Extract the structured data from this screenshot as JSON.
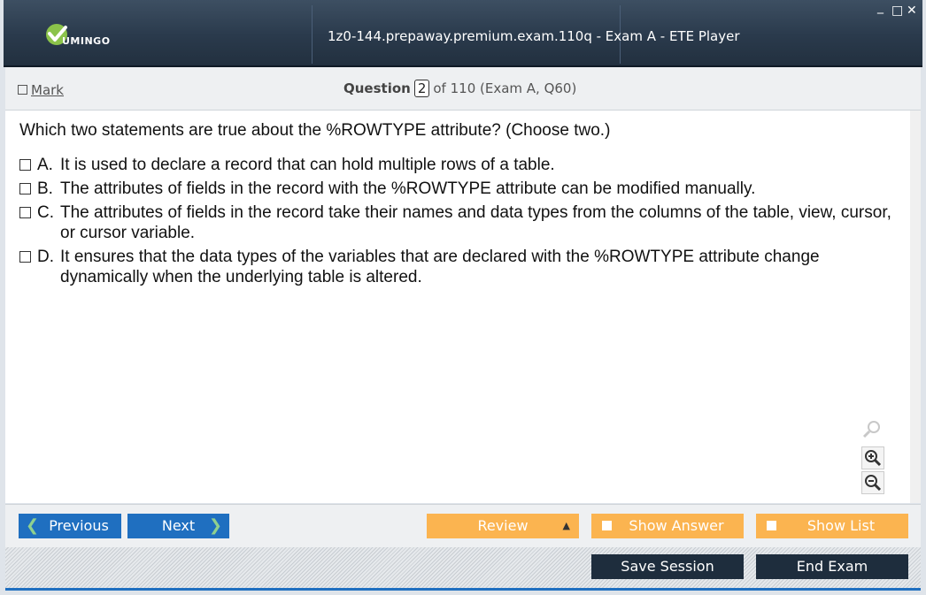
{
  "app": {
    "logo_text": "UMINGO",
    "window_title": "1z0-144.prepaway.premium.exam.110q - Exam A - ETE Player",
    "minimize": "_",
    "maximize": "□",
    "close": "✕"
  },
  "header": {
    "mark_label": "Mark",
    "question_label": "Question",
    "question_number": "2",
    "question_suffix": "of 110 (Exam A, Q60)"
  },
  "question": {
    "text": "Which two statements are true about the %ROWTYPE attribute? (Choose two.)",
    "options": [
      {
        "letter": "A.",
        "text": "It is used to declare a record that can hold multiple rows of a table."
      },
      {
        "letter": "B.",
        "text": "The attributes of fields in the record with the %ROWTYPE attribute can be modified manually."
      },
      {
        "letter": "C.",
        "text": "The attributes of fields in the record take their names and data types from the columns of the table, view, cursor, or cursor variable."
      },
      {
        "letter": "D.",
        "text": "It ensures that the data types of the variables that are declared with the %ROWTYPE attribute change dynamically when the underlying table is altered."
      }
    ]
  },
  "footer": {
    "previous": "Previous",
    "next": "Next",
    "review": "Review",
    "show_answer": "Show Answer",
    "show_list": "Show List",
    "save_session": "Save Session",
    "end_exam": "End Exam"
  },
  "colors": {
    "accent_blue": "#1f6fc0",
    "orange": "#fbb450",
    "dark": "#1e2d3d"
  }
}
